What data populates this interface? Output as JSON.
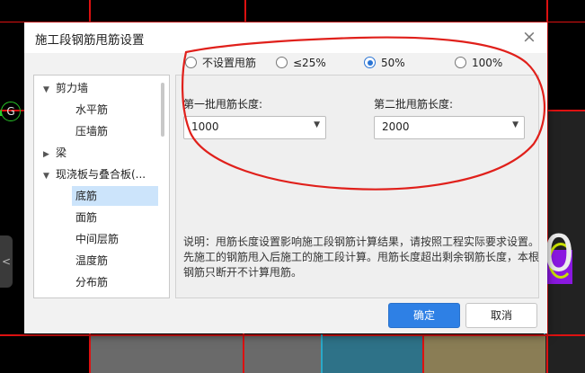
{
  "dialog": {
    "title": "施工段钢筋甩筋设置",
    "close_glyph": "×"
  },
  "background": {
    "axis_label": "G",
    "big_digit": "0",
    "handle_glyph": "<"
  },
  "tree": {
    "items": [
      {
        "label": "剪力墙",
        "level": 0,
        "expanded": true
      },
      {
        "label": "水平筋",
        "level": 1
      },
      {
        "label": "压墙筋",
        "level": 1
      },
      {
        "label": "梁",
        "level": 0,
        "expanded": false
      },
      {
        "label": "现浇板与叠合板(...",
        "level": 0,
        "expanded": true
      },
      {
        "label": "底筋",
        "level": 1,
        "selected": true
      },
      {
        "label": "面筋",
        "level": 1
      },
      {
        "label": "中间层筋",
        "level": 1
      },
      {
        "label": "温度筋",
        "level": 1
      },
      {
        "label": "分布筋",
        "level": 1
      }
    ],
    "expanded_glyph": "▼",
    "collapsed_glyph": "▶"
  },
  "options": {
    "radios": [
      {
        "label": "不设置甩筋",
        "checked": false
      },
      {
        "label": "≤25%",
        "checked": false
      },
      {
        "label": "50%",
        "checked": true
      },
      {
        "label": "100%",
        "checked": false
      }
    ]
  },
  "first_batch": {
    "label": "第一批甩筋长度:",
    "value": "1000"
  },
  "second_batch": {
    "label": "第二批甩筋长度:",
    "value": "2000"
  },
  "dropdown_glyph": "▼",
  "note": "说明：甩筋长度设置影响施工段钢筋计算结果，请按照工程实际要求设置。先施工的钢筋甩入后施工的施工段计算。甩筋长度超出剩余钢筋长度，本根钢筋只断开不计算甩筋。",
  "buttons": {
    "ok": "确定",
    "cancel": "取消"
  },
  "colors": {
    "accent": "#2e80e5",
    "annotation": "#e0201b",
    "selected_row": "#cce4fb",
    "cad_background": "#000000"
  }
}
